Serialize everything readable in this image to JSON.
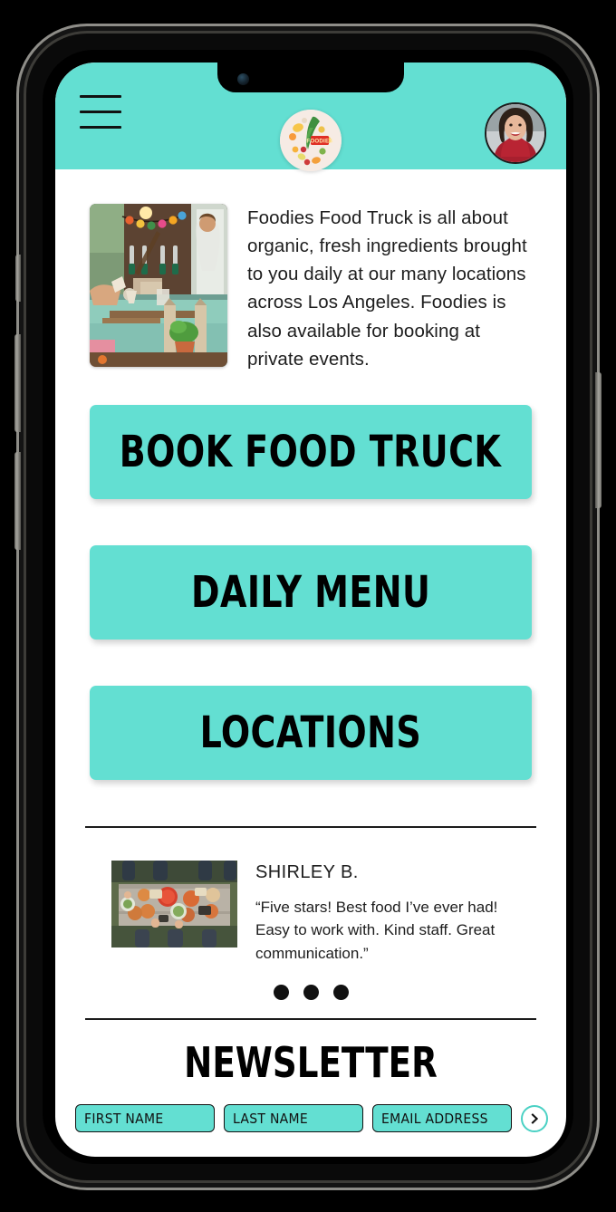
{
  "device": {
    "notch_icons": [
      "speaker-grille",
      "front-camera"
    ],
    "buttons": [
      "mute-switch",
      "volume-up",
      "volume-down",
      "power"
    ]
  },
  "theme": {
    "accent": "#63dfd2",
    "text": "#1d1d1d",
    "dark": "#111111",
    "page_bg": "#ffffff"
  },
  "header": {
    "menu_icon": "hamburger-menu-icon",
    "logo_icon": "foodies-logo-icon",
    "logo_badge_text": "FOODIES",
    "avatar_icon": "user-avatar-icon"
  },
  "intro": {
    "photo_icon": "food-truck-photo",
    "text": "Foodies Food Truck is all about organic, fresh ingredients brought to you daily at our many locations across Los Angeles. Foodies is also available for booking at private events."
  },
  "cta_buttons": [
    {
      "label": "BOOK FOOD TRUCK",
      "name": "book-food-truck-button"
    },
    {
      "label": "DAILY MENU",
      "name": "daily-menu-button"
    },
    {
      "label": "LOCATIONS",
      "name": "locations-button"
    }
  ],
  "testimonial": {
    "photo_icon": "table-of-food-photo",
    "author": "SHIRLEY B.",
    "quote": "“Five stars! Best food I’ve ever had! Easy to work with. Kind staff. Great communication.”",
    "dots": 3,
    "active_dot": 0
  },
  "newsletter": {
    "title": "NEWSLETTER",
    "first_name_placeholder": "FIRST NAME",
    "last_name_placeholder": "LAST NAME",
    "email_placeholder": "EMAIL ADDRESS",
    "first_name_value": "",
    "last_name_value": "",
    "email_value": "",
    "submit_icon": "chevron-right-icon"
  }
}
